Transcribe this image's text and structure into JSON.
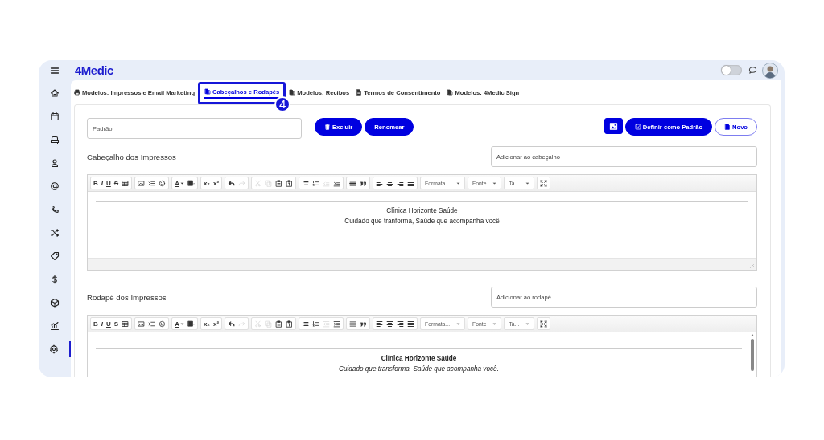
{
  "top_bar": {
    "logo": "4Medic",
    "theme_toggle": {
      "on": false
    }
  },
  "sidebar": {
    "items": [
      {
        "kind": "home",
        "selected": false
      },
      {
        "kind": "calendar",
        "selected": false
      },
      {
        "kind": "couch",
        "selected": false
      },
      {
        "kind": "person",
        "selected": false
      },
      {
        "kind": "at",
        "selected": false
      },
      {
        "kind": "phone",
        "selected": false
      },
      {
        "kind": "shuffle",
        "selected": false
      },
      {
        "kind": "tag",
        "selected": false
      },
      {
        "kind": "dollar",
        "selected": false
      },
      {
        "kind": "box",
        "selected": false
      },
      {
        "kind": "chart",
        "selected": false
      },
      {
        "kind": "settings",
        "selected": true
      }
    ]
  },
  "tabs": [
    {
      "kind": "print",
      "label": "Modelos: Impressos e Email Marketing",
      "selected": false
    },
    {
      "kind": "pages",
      "label": "Cabeçalhos e Rodapés",
      "selected": true
    },
    {
      "kind": "pages",
      "label": "Modelos: Recibos",
      "selected": false
    },
    {
      "kind": "doc",
      "label": "Termos de Consentimento",
      "selected": false
    },
    {
      "kind": "pages",
      "label": "Modelos: 4Medic Sign",
      "selected": false
    }
  ],
  "callout": {
    "number": "4"
  },
  "template_field": {
    "value": "Padrão"
  },
  "buttons": [
    {
      "kind": "delete",
      "label": "Excluir"
    },
    {
      "kind": "plain",
      "label": "Renomear"
    },
    {
      "kind": "image"
    },
    {
      "kind": "default",
      "label": "Definir como Padrão"
    },
    {
      "kind": "new",
      "label": "Novo"
    }
  ],
  "sections": [
    {
      "title": "Cabeçalho dos Impressos",
      "add_field": {
        "placeholder": "Adicionar ao cabeçalho"
      },
      "editor": {
        "scrollable": false,
        "status_bar": true,
        "toolbar": [
          [
            {
              "kind": "bold",
              "label": "B",
              "disabled": false
            },
            {
              "kind": "italic",
              "label": "I",
              "disabled": false
            },
            {
              "kind": "underline",
              "label": "U",
              "disabled": false
            },
            {
              "kind": "strike",
              "label": "S",
              "disabled": false
            },
            {
              "kind": "table",
              "disabled": false
            }
          ],
          [
            {
              "kind": "image",
              "disabled": false
            },
            {
              "kind": "list-insert",
              "disabled": false
            },
            {
              "kind": "emoji",
              "disabled": false
            }
          ],
          [
            {
              "kind": "text-color",
              "label": "A",
              "disabled": false
            },
            {
              "kind": "bg-color",
              "disabled": false
            }
          ],
          [
            {
              "kind": "subscript",
              "label": "x₂",
              "disabled": false
            },
            {
              "kind": "superscript",
              "label": "x²",
              "disabled": false
            }
          ],
          [
            {
              "kind": "undo",
              "disabled": false
            },
            {
              "kind": "redo",
              "disabled": true
            }
          ],
          [
            {
              "kind": "cut",
              "disabled": true
            },
            {
              "kind": "copy",
              "disabled": true
            },
            {
              "kind": "paste",
              "disabled": false
            },
            {
              "kind": "paste-text",
              "disabled": false
            }
          ],
          [
            {
              "kind": "bullets",
              "disabled": false
            },
            {
              "kind": "numbers",
              "disabled": false
            },
            {
              "kind": "outdent",
              "disabled": true
            },
            {
              "kind": "indent",
              "disabled": false
            }
          ],
          [
            {
              "kind": "rule",
              "disabled": false
            },
            {
              "kind": "quote",
              "disabled": false
            }
          ],
          [
            {
              "kind": "align-left",
              "disabled": false
            },
            {
              "kind": "align-center",
              "disabled": false
            },
            {
              "kind": "align-right",
              "disabled": false
            },
            {
              "kind": "justify",
              "disabled": false
            }
          ],
          [
            {
              "kind": "dropdown",
              "label": "Formata...",
              "disabled": false
            }
          ],
          [
            {
              "kind": "dropdown",
              "label": "Fonte",
              "disabled": false
            }
          ],
          [
            {
              "kind": "dropdown",
              "label": "Ta...",
              "disabled": false
            }
          ],
          [
            {
              "kind": "maximize",
              "disabled": false
            }
          ]
        ],
        "lines": [
          {
            "kind": "normal",
            "text": "Clínica Horizonte Saúde"
          },
          {
            "kind": "normal",
            "text": "Cuidado que tranforma, Saúde que acompanha você"
          }
        ]
      }
    },
    {
      "title": "Rodapé dos Impressos",
      "add_field": {
        "placeholder": "Adicionar ao rodapé"
      },
      "editor": {
        "scrollable": true,
        "status_bar": false,
        "toolbar": [
          [
            {
              "kind": "bold",
              "label": "B",
              "disabled": false
            },
            {
              "kind": "italic",
              "label": "I",
              "disabled": false
            },
            {
              "kind": "underline",
              "label": "U",
              "disabled": false
            },
            {
              "kind": "strike",
              "label": "S",
              "disabled": false
            },
            {
              "kind": "table",
              "disabled": false
            }
          ],
          [
            {
              "kind": "image",
              "disabled": false
            },
            {
              "kind": "list-insert",
              "disabled": false
            },
            {
              "kind": "emoji",
              "disabled": false
            }
          ],
          [
            {
              "kind": "text-color",
              "label": "A",
              "disabled": false
            },
            {
              "kind": "bg-color",
              "disabled": false
            }
          ],
          [
            {
              "kind": "subscript",
              "label": "x₂",
              "disabled": false
            },
            {
              "kind": "superscript",
              "label": "x²",
              "disabled": false
            }
          ],
          [
            {
              "kind": "undo",
              "disabled": false
            },
            {
              "kind": "redo",
              "disabled": true
            }
          ],
          [
            {
              "kind": "cut",
              "disabled": true
            },
            {
              "kind": "copy",
              "disabled": true
            },
            {
              "kind": "paste",
              "disabled": false
            },
            {
              "kind": "paste-text",
              "disabled": false
            }
          ],
          [
            {
              "kind": "bullets",
              "disabled": false
            },
            {
              "kind": "numbers",
              "disabled": false
            },
            {
              "kind": "outdent",
              "disabled": true
            },
            {
              "kind": "indent",
              "disabled": false
            }
          ],
          [
            {
              "kind": "rule",
              "disabled": false
            },
            {
              "kind": "quote",
              "disabled": false
            }
          ],
          [
            {
              "kind": "align-left",
              "disabled": false
            },
            {
              "kind": "align-center",
              "disabled": false
            },
            {
              "kind": "align-right",
              "disabled": false
            },
            {
              "kind": "justify",
              "disabled": false
            }
          ],
          [
            {
              "kind": "dropdown",
              "label": "Formata...",
              "disabled": false
            }
          ],
          [
            {
              "kind": "dropdown",
              "label": "Fonte",
              "disabled": false
            }
          ],
          [
            {
              "kind": "dropdown",
              "label": "Ta...",
              "disabled": false
            }
          ],
          [
            {
              "kind": "maximize",
              "disabled": false
            }
          ]
        ],
        "lines": [
          {
            "kind": "bold",
            "text": "Clínica Horizonte Saúde"
          },
          {
            "kind": "italic",
            "text": "Cuidado que transforma. Saúde que acompanha você."
          }
        ]
      }
    }
  ]
}
